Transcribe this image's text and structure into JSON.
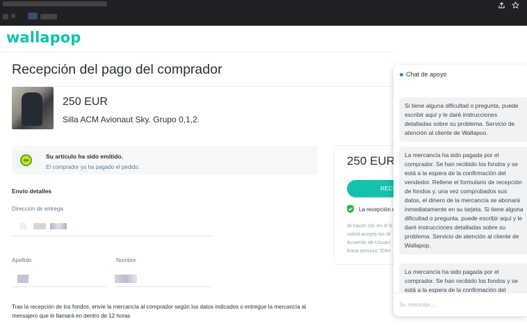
{
  "browser": {
    "share_icon": "share-icon",
    "star_icon": "bookmark-star-icon"
  },
  "brand": {
    "logo": "wallapop",
    "accent": "#13c1ac"
  },
  "page": {
    "title": "Recepción del pago del comprador"
  },
  "product": {
    "price": "250 EUR",
    "title": "Silla ACM Avionaut Sky. Grupo 0,1,2."
  },
  "notice": {
    "title": "Su artículo ha sido emitido.",
    "subtitle": "El comprador ya ha pagado el pedido."
  },
  "shipping": {
    "section_label": "Envío detalles",
    "address_label": "Dirección de entrega",
    "lastname_label": "Apellido",
    "name_label": "Nombre",
    "footer_text": "Tras la recepción de los fondos, envíe la mercancía al comprador según los datos indicados o entregue la mercancía al mensajero que le llamará en dentro de 12 horas"
  },
  "payment_card": {
    "price": "250 EUR",
    "button_label": "RECI",
    "check_text": "La recepción d",
    "legal_text": "Al hacer clic en el b usted acepta los té Acuerdo de Usuari línea servicio \"Ofer"
  },
  "chat": {
    "title": "Chat de apoyo",
    "messages": [
      "Si tiene alguna dificultad o pregunta, puede escribir aquí y le daré instrucciones detalladas sobre su problema. Servicio de atención al cliente de Wallapoo.",
      "La mercancía ha sido pagada por el comprador. Se han recibido los fondos y se está a la espera de la confirmación del vendedor. Rellene el formulario de recepción de fondos y, una vez comprobados sus datos, el dinero de la mercancía se abonará inmediatamente en su tarjeta. Si tiene alguna dificultad o pregunta, puede escribir aquí y le daré instrucciones detalladas sobre su problema. Servicio de atención al cliente de Wallapop.",
      "La mercancía ha sido pagada por el comprador. Se han recibido los fondos y se está a la espera de la confirmación del"
    ],
    "input_placeholder": "Su mensaje..."
  }
}
